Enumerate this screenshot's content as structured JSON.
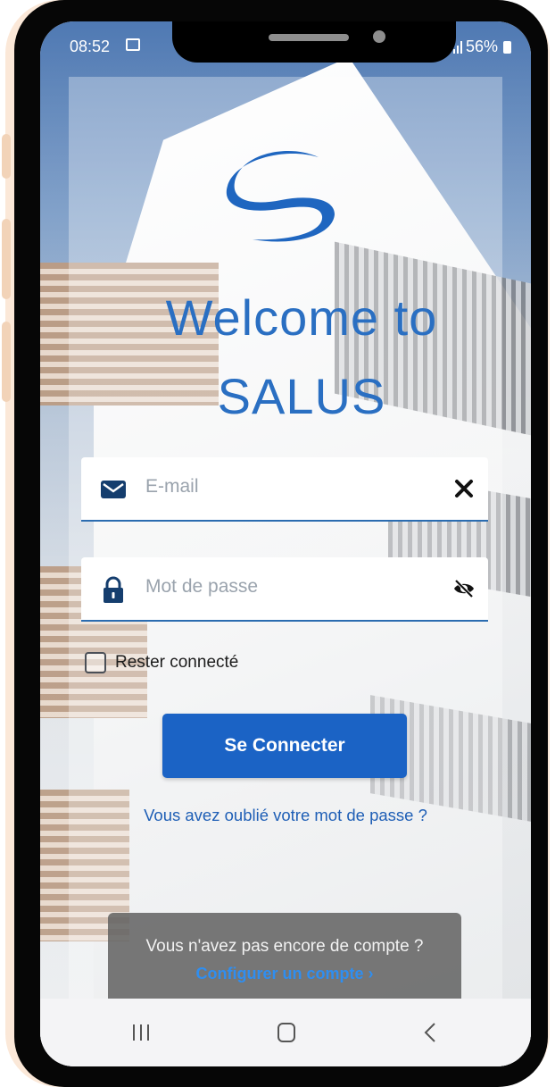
{
  "status_bar": {
    "time": "08:52",
    "battery": "56%"
  },
  "app": {
    "title_line1": "Welcome to",
    "title_line2": "SALUS",
    "brand_color": "#2a6fc2"
  },
  "form": {
    "email_placeholder": "E-mail",
    "password_placeholder": "Mot de passe",
    "remember_label": "Rester connecté",
    "remember_checked": false,
    "connect_label": "Se Connecter",
    "forgot_label": "Vous avez oublié votre mot de passe ?"
  },
  "account": {
    "question": "Vous n'avez pas encore de compte ?",
    "configure_label": "Configurer un compte ›"
  },
  "icons": {
    "email": "envelope-icon",
    "password": "lock-icon",
    "clear": "close-icon",
    "visibility": "eye-slash-icon"
  }
}
